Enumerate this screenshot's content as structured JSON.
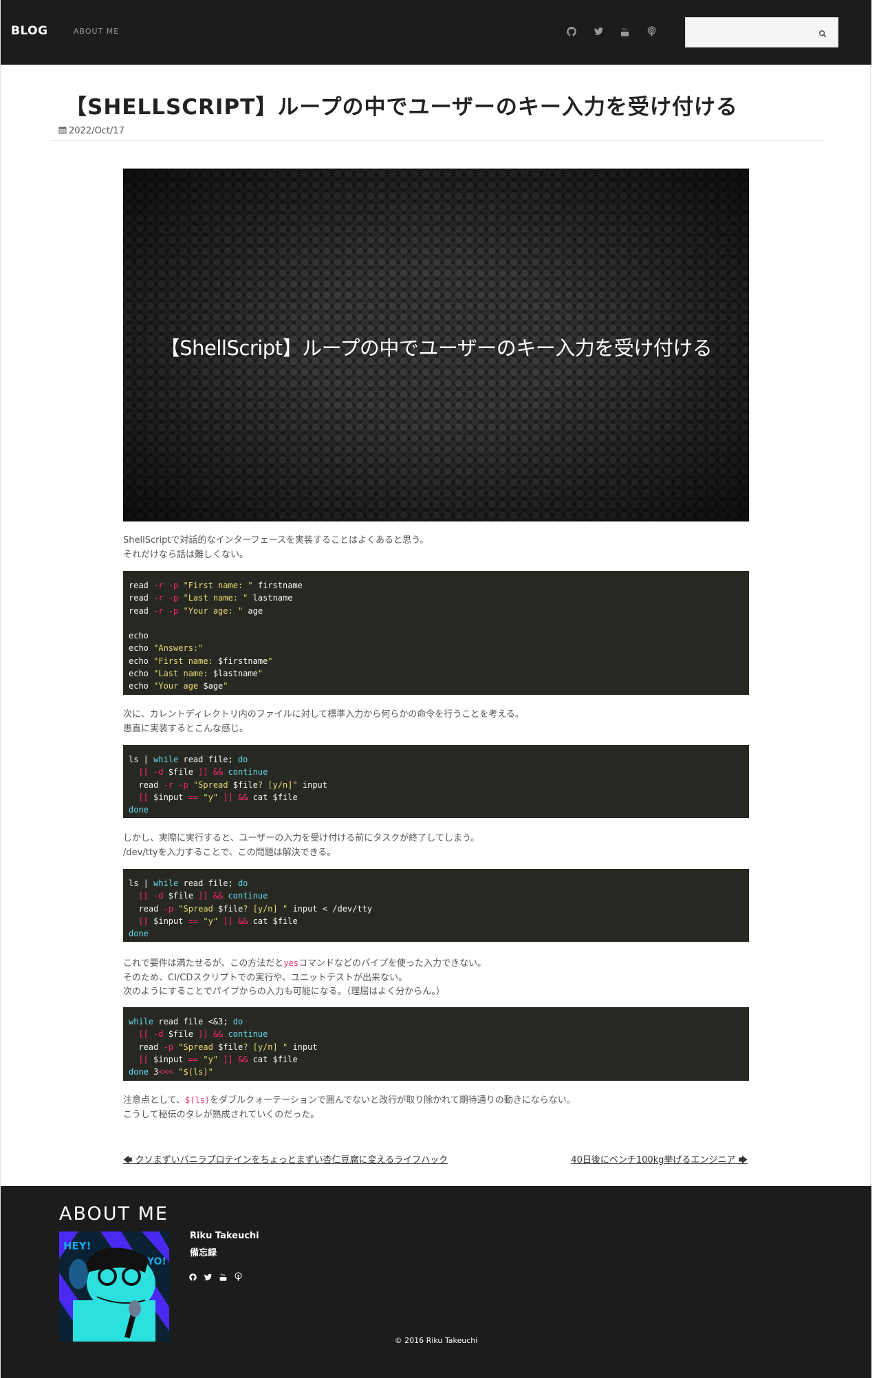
{
  "nav": {
    "brand": "BLOG",
    "links": [
      {
        "label": "ABOUT ME"
      }
    ],
    "social_icons": [
      "github-icon",
      "twitter-icon",
      "youtube-icon",
      "podcast-icon"
    ],
    "search": {
      "value": "",
      "placeholder": ""
    }
  },
  "post": {
    "title": "【SHELLSCRIPT】ループの中でユーザーのキー入力を受け付ける",
    "date": "2022/Oct/17",
    "hero_text": "【ShellScript】ループの中でユーザーのキー入力を受け付ける",
    "paragraphs": [
      [
        [
          {
            "t": "ShellScriptで対話的なインターフェースを実装することはよくあると思う。"
          }
        ],
        [
          {
            "t": "それだけなら話は難しくない。"
          }
        ]
      ],
      [
        [
          {
            "t": "次に、カレントディレクトリ内のファイルに対して標準入力から何らかの命令を行うことを考える。"
          }
        ],
        [
          {
            "t": "愚直に実装するとこんな感じ。"
          }
        ]
      ],
      [
        [
          {
            "t": "しかし、実際に実行すると、ユーザーの入力を受け付ける前にタスクが終了してしまう。"
          }
        ],
        [
          {
            "t": "/dev/ttyを入力することで、この問題は解決できる。"
          }
        ]
      ],
      [
        [
          {
            "t": "これで要件は満たせるが、この方法だと"
          },
          {
            "t": "yes",
            "code": true
          },
          {
            "t": "コマンドなどのパイプを使った入力できない。"
          }
        ],
        [
          {
            "t": "そのため、CI/CDスクリプトでの実行や、ユニットテストが出来ない。"
          }
        ],
        [
          {
            "t": "次のようにすることでパイプからの入力も可能になる。（理屈はよく分からん。）"
          }
        ]
      ],
      [
        [
          {
            "t": "注意点として、"
          },
          {
            "t": "$(ls)",
            "code": true
          },
          {
            "t": "をダブルクォーテーションで囲んでないと改行が取り除かれて期待通りの動きにならない。"
          }
        ],
        [
          {
            "t": "こうして秘伝のタレが熟成されていくのだった。"
          }
        ]
      ]
    ],
    "code_blocks": [
      [
        [
          [
            "read ",
            ""
          ],
          [
            "-r -p",
            "op"
          ],
          [
            " ",
            ""
          ],
          [
            "\"First name: \"",
            "st"
          ],
          [
            " firstname",
            ""
          ]
        ],
        [
          [
            "read ",
            ""
          ],
          [
            "-r -p",
            "op"
          ],
          [
            " ",
            ""
          ],
          [
            "\"Last name: \"",
            "st"
          ],
          [
            " lastname",
            ""
          ]
        ],
        [
          [
            "read ",
            ""
          ],
          [
            "-r -p",
            "op"
          ],
          [
            " ",
            ""
          ],
          [
            "\"Your age: \"",
            "st"
          ],
          [
            " age",
            ""
          ]
        ],
        [
          [
            "",
            ""
          ]
        ],
        [
          [
            "echo",
            ""
          ]
        ],
        [
          [
            "echo ",
            ""
          ],
          [
            "\"Answers:\"",
            "st"
          ]
        ],
        [
          [
            "echo ",
            ""
          ],
          [
            "\"First name: ",
            "st"
          ],
          [
            "$firstname",
            ""
          ],
          [
            "\"",
            "st"
          ]
        ],
        [
          [
            "echo ",
            ""
          ],
          [
            "\"Last name: ",
            "st"
          ],
          [
            "$lastname",
            ""
          ],
          [
            "\"",
            "st"
          ]
        ],
        [
          [
            "echo ",
            ""
          ],
          [
            "\"Your age ",
            "st"
          ],
          [
            "$age",
            ""
          ],
          [
            "\"",
            "st"
          ]
        ]
      ],
      [
        [
          [
            "ls | ",
            ""
          ],
          [
            "while",
            "kw"
          ],
          [
            " read file; ",
            ""
          ],
          [
            "do",
            "kw"
          ]
        ],
        [
          [
            "  ",
            ""
          ],
          [
            "[[ -d",
            "op"
          ],
          [
            " $file ",
            ""
          ],
          [
            "]] &&",
            "op"
          ],
          [
            " ",
            ""
          ],
          [
            "continue",
            "kw"
          ]
        ],
        [
          [
            "  read ",
            ""
          ],
          [
            "-r -p",
            "op"
          ],
          [
            " ",
            ""
          ],
          [
            "\"Spread ",
            "st"
          ],
          [
            "$file",
            ""
          ],
          [
            "? [y/n]\"",
            "st"
          ],
          [
            " input",
            ""
          ]
        ],
        [
          [
            "  ",
            ""
          ],
          [
            "[[",
            "op"
          ],
          [
            " $input ",
            ""
          ],
          [
            "==",
            "op"
          ],
          [
            " ",
            ""
          ],
          [
            "\"y\"",
            "st"
          ],
          [
            " ",
            ""
          ],
          [
            "]] &&",
            "op"
          ],
          [
            " cat $file",
            ""
          ]
        ],
        [
          [
            "done",
            "kw"
          ]
        ]
      ],
      [
        [
          [
            "ls | ",
            ""
          ],
          [
            "while",
            "kw"
          ],
          [
            " read file; ",
            ""
          ],
          [
            "do",
            "kw"
          ]
        ],
        [
          [
            "  ",
            ""
          ],
          [
            "[[ -d",
            "op"
          ],
          [
            " $file ",
            ""
          ],
          [
            "]] &&",
            "op"
          ],
          [
            " ",
            ""
          ],
          [
            "continue",
            "kw"
          ]
        ],
        [
          [
            "  read ",
            ""
          ],
          [
            "-p",
            "op"
          ],
          [
            " ",
            ""
          ],
          [
            "\"Spread ",
            "st"
          ],
          [
            "$file",
            ""
          ],
          [
            "? [y/n] \"",
            "st"
          ],
          [
            " input < /dev/tty",
            ""
          ]
        ],
        [
          [
            "  ",
            ""
          ],
          [
            "[[",
            "op"
          ],
          [
            " $input ",
            ""
          ],
          [
            "==",
            "op"
          ],
          [
            " ",
            ""
          ],
          [
            "\"y\"",
            "st"
          ],
          [
            " ",
            ""
          ],
          [
            "]] &&",
            "op"
          ],
          [
            " cat $file",
            ""
          ]
        ],
        [
          [
            "done",
            "kw"
          ]
        ]
      ],
      [
        [
          [
            "while",
            "kw"
          ],
          [
            " read file <&3; ",
            ""
          ],
          [
            "do",
            "kw"
          ]
        ],
        [
          [
            "  ",
            ""
          ],
          [
            "[[ -d",
            "op"
          ],
          [
            " $file ",
            ""
          ],
          [
            "]] &&",
            "op"
          ],
          [
            " ",
            ""
          ],
          [
            "continue",
            "kw"
          ]
        ],
        [
          [
            "  read ",
            ""
          ],
          [
            "-p",
            "op"
          ],
          [
            " ",
            ""
          ],
          [
            "\"Spread ",
            "st"
          ],
          [
            "$file",
            ""
          ],
          [
            "? [y/n] \"",
            "st"
          ],
          [
            " input",
            ""
          ]
        ],
        [
          [
            "  ",
            ""
          ],
          [
            "[[",
            "op"
          ],
          [
            " $input ",
            ""
          ],
          [
            "==",
            "op"
          ],
          [
            " ",
            ""
          ],
          [
            "\"y\"",
            "st"
          ],
          [
            " ",
            ""
          ],
          [
            "]] &&",
            "op"
          ],
          [
            " cat $file",
            ""
          ]
        ],
        [
          [
            "done",
            "kw"
          ],
          [
            " 3",
            ""
          ],
          [
            "<<<",
            "op"
          ],
          [
            " ",
            ""
          ],
          [
            "\"$(ls)\"",
            "st"
          ]
        ]
      ]
    ],
    "prev_post": "クソまずいバニラプロテインをちょっとまずい杏仁豆腐に変えるライフハック",
    "next_post": "40日後にベンチ100kg挙げるエンジニア"
  },
  "footer": {
    "heading": "ABOUT ME",
    "avatar_text": [
      "HEY!",
      "YO!"
    ],
    "name": "Riku Takeuchi",
    "description": "備忘録",
    "copyright": "© 2016 Riku Takeuchi"
  },
  "colors": {
    "nav_bg": "#1c1c1c",
    "code_bg": "#272822",
    "keyword": "#66d9ef",
    "operator": "#f92672",
    "string": "#e6db74"
  }
}
